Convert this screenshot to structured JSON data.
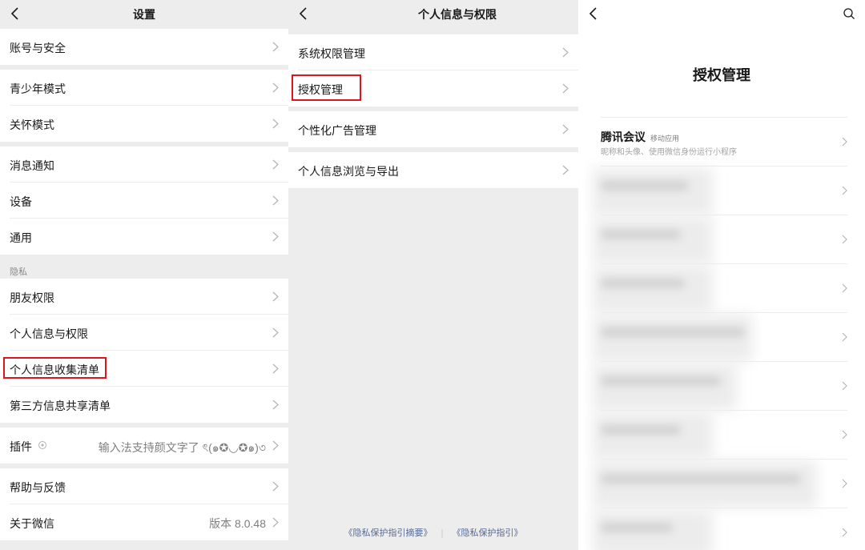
{
  "settings": {
    "title": "设置",
    "rows": {
      "account": "账号与安全",
      "teen": "青少年模式",
      "care": "关怀模式",
      "notify": "消息通知",
      "device": "设备",
      "general": "通用",
      "friends": "朋友权限",
      "personal_info": "个人信息与权限",
      "collect_list": "个人信息收集清单",
      "third_party": "第三方信息共享清单",
      "plugins": "插件",
      "plugins_value": "输入法支持颜文字了 ৎ(๑✪◡✪๑)৩",
      "help": "帮助与反馈",
      "about": "关于微信",
      "about_value": "版本 8.0.48"
    },
    "privacy_section": "隐私"
  },
  "personal": {
    "title": "个人信息与权限",
    "rows": {
      "system_perm": "系统权限管理",
      "auth": "授权管理",
      "ads": "个性化广告管理",
      "browse": "个人信息浏览与导出"
    },
    "footer": {
      "summary": "《隐私保护指引摘要》",
      "sep": "|",
      "guide": "《隐私保护指引》"
    }
  },
  "auth": {
    "title": "授权管理",
    "app": {
      "name": "腾讯会议",
      "tag": "移动应用",
      "desc": "昵称和头像、使用微信身份运行小程序"
    }
  },
  "colors": {
    "highlight": "#e0141e",
    "link": "#576b95",
    "background": "#ededed"
  }
}
